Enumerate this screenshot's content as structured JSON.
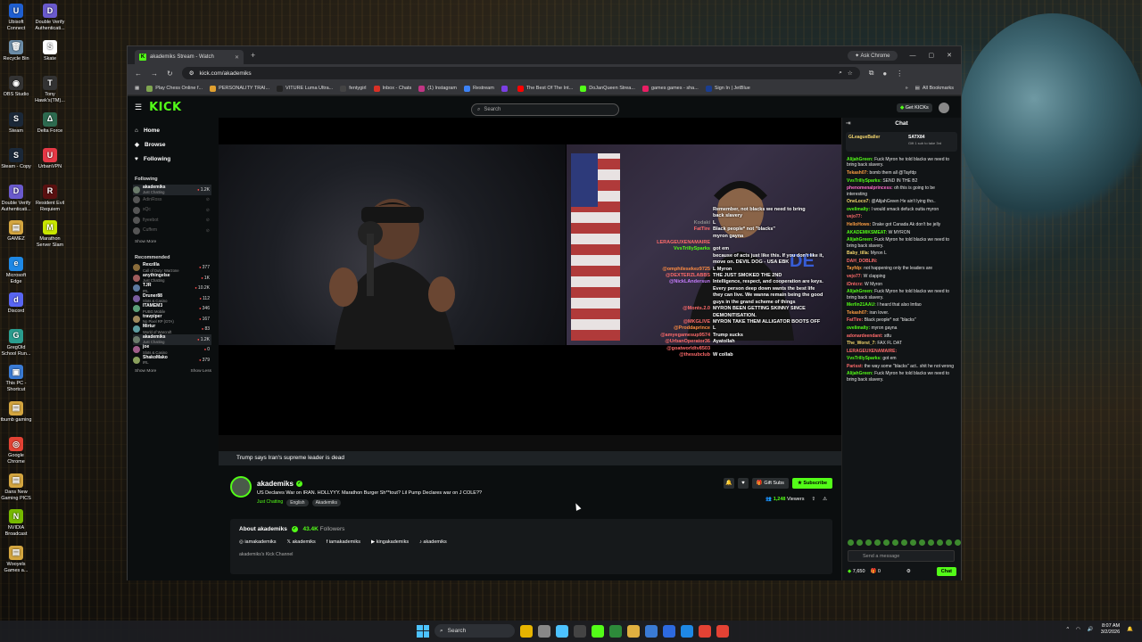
{
  "desktop": {
    "icons": [
      {
        "label": "Ubisoft Connect",
        "color": "#1f5fd1",
        "glyph": "U"
      },
      {
        "label": "Recycle Bin",
        "color": "#6b8ca8",
        "glyph": "🗑"
      },
      {
        "label": "OBS Studio",
        "color": "#333333",
        "glyph": "◉"
      },
      {
        "label": "Steam",
        "color": "#1b2838",
        "glyph": "S"
      },
      {
        "label": "Steam - Copy",
        "color": "#1b2838",
        "glyph": "S"
      },
      {
        "label": "Double Verify Authenticati...",
        "color": "#6a5acd",
        "glyph": "D"
      },
      {
        "label": "GAMEZ",
        "color": "#d4a640",
        "glyph": "▤"
      },
      {
        "label": "Microsoft Edge",
        "color": "#1e88e5",
        "glyph": "e"
      },
      {
        "label": "Discord",
        "color": "#5865f2",
        "glyph": "d"
      },
      {
        "label": "GregOld School Run...",
        "color": "#2a9d8f",
        "glyph": "G"
      },
      {
        "label": "This PC - Shortcut",
        "color": "#3a7bd5",
        "glyph": "▣"
      },
      {
        "label": "tbumb gaming",
        "color": "#d4a640",
        "glyph": "▤"
      },
      {
        "label": "Google Chrome",
        "color": "#e34234",
        "glyph": "◎"
      },
      {
        "label": "Dans New Gaming PICS",
        "color": "#d4a640",
        "glyph": "▤"
      },
      {
        "label": "NVIDIA Broadcast",
        "color": "#76b900",
        "glyph": "N"
      },
      {
        "label": "Wooyels Games a...",
        "color": "#d4a640",
        "glyph": "▤"
      }
    ],
    "icons_col2": [
      {
        "label": "Double Verify Authenticati...",
        "color": "#6a5acd",
        "glyph": "D"
      },
      {
        "label": "Skate",
        "color": "#ffffff",
        "glyph": "S"
      },
      {
        "label": "Tony Hawk's(TM)...",
        "color": "#333333",
        "glyph": "T"
      },
      {
        "label": "Delta Force",
        "color": "#2d6a4f",
        "glyph": "Δ"
      },
      {
        "label": "UrbanVPN",
        "color": "#e63946",
        "glyph": "U"
      },
      {
        "label": "Resident Evil Requiem",
        "color": "#5a1010",
        "glyph": "R"
      },
      {
        "label": "Marathon Server Slam",
        "color": "#c8e600",
        "glyph": "M"
      }
    ]
  },
  "browser": {
    "tab_title": "akademiks Stream - Watch",
    "ask_chrome": "Ask Chrome",
    "url": "kick.com/akademiks",
    "bookmarks": [
      {
        "label": "Play Chess Online f...",
        "color": "#7fa650"
      },
      {
        "label": "PERSONALITY TRAI...",
        "color": "#e0a030"
      },
      {
        "label": "VITURE Luma Ultra...",
        "color": "#222222"
      },
      {
        "label": "fentygirl",
        "color": "#444444"
      },
      {
        "label": "Inbox - Chats",
        "color": "#d93025"
      },
      {
        "label": "(1) Instagram",
        "color": "#c13584"
      },
      {
        "label": "Restream",
        "color": "#3c82f6"
      },
      {
        "label": "",
        "color": "#7b3fe4"
      },
      {
        "label": "The Best Of The Int...",
        "color": "#ff0000"
      },
      {
        "label": "DoJanQueen Strea...",
        "color": "#53fc18"
      },
      {
        "label": "games games - sha...",
        "color": "#e91e63"
      },
      {
        "label": "Sign In | JetBlue",
        "color": "#1a3d8f"
      }
    ],
    "all_bookmarks": "All Bookmarks"
  },
  "kick": {
    "logo": "KICK",
    "search_placeholder": "Search",
    "get_kicks": "Get KICKs",
    "nav": [
      {
        "label": "Home",
        "icon": "home-icon"
      },
      {
        "label": "Browse",
        "icon": "browse-icon"
      },
      {
        "label": "Following",
        "icon": "heart-icon"
      }
    ],
    "following_header": "Following",
    "following": [
      {
        "name": "akademiks",
        "sub": "Just Chatting",
        "viewers": "1.2K",
        "live": true,
        "color": "#6b7b6b"
      },
      {
        "name": "AdinRoss",
        "sub": "",
        "viewers": "",
        "live": false,
        "color": "#555555"
      },
      {
        "name": "xQc",
        "sub": "",
        "viewers": "",
        "live": false,
        "color": "#555555"
      },
      {
        "name": "fiyeebot",
        "sub": "",
        "viewers": "",
        "live": false,
        "color": "#555555"
      },
      {
        "name": "Cuffem",
        "sub": "",
        "viewers": "",
        "live": false,
        "color": "#555555"
      }
    ],
    "show_more_1": "Show More",
    "recommended_header": "Recommended",
    "recommended": [
      {
        "name": "Rexzilla",
        "sub": "Call of Duty: Warzone",
        "viewers": "377",
        "color": "#8a6d3b"
      },
      {
        "name": "anythingelse",
        "sub": "Just Chatting",
        "viewers": "1K",
        "color": "#a05d5d"
      },
      {
        "name": "TJR",
        "sub": "IRL",
        "viewers": "10.2K",
        "color": "#5d7aa0"
      },
      {
        "name": "Druner88",
        "sub": "Slots & Casino",
        "viewers": "112",
        "color": "#7a5da0"
      },
      {
        "name": "ITAMEM3",
        "sub": "PUBG Mobile",
        "viewers": "346",
        "color": "#5da07a"
      },
      {
        "name": "travpiper",
        "sub": "No Pixel RP (GTA)",
        "viewers": "167",
        "color": "#a08a5d"
      },
      {
        "name": "Mirtur",
        "sub": "World of Warcraft",
        "viewers": "83",
        "color": "#5d9ca0"
      },
      {
        "name": "akademiks",
        "sub": "Just Chatting",
        "viewers": "1.2K",
        "color": "#6b7b6b"
      },
      {
        "name": "joe",
        "sub": "Slots & Casino",
        "viewers": "0",
        "color": "#a05d8a"
      },
      {
        "name": "ShakoMako",
        "sub": "IRL",
        "viewers": "379",
        "color": "#8aa05d"
      }
    ],
    "show_more_2": "Show More",
    "show_less": "Show Less",
    "overlay_chat": [
      {
        "user": "",
        "text": "Remember, not blacks we need to bring",
        "color": "#888888"
      },
      {
        "user": "",
        "text": "back slavery",
        "color": "#888888"
      },
      {
        "user": "Kodaki",
        "text": "L",
        "color": "#888888"
      },
      {
        "user": "FatTire",
        "text": "Black people* not \"blacks\"",
        "color": "#ff6b6b"
      },
      {
        "user": "",
        "text": "myron gayna",
        "color": "#ff8c42"
      },
      {
        "user": "LERAGEUXENAMAIRE",
        "text": "",
        "color": "#ff6b6b"
      },
      {
        "user": "VvsTrillySparks",
        "text": "got em",
        "color": "#53fc18"
      },
      {
        "user": "",
        "text": "because of acts just like this. If you don't like it,",
        "color": "#ffffff"
      },
      {
        "user": "",
        "text": "move on. DEVIL DOG - USA EBK",
        "color": "#ffffff"
      },
      {
        "user": "@omphilesekez9725",
        "text": "L Myron",
        "color": "#ff8c42"
      },
      {
        "user": "@DEXTERZLABBS",
        "text": "THE JUST SMOKED THE 2ND",
        "color": "#ff6b6b"
      },
      {
        "user": "@NickLAndersun",
        "text": "Intelligence, respect, and cooperation are keys.",
        "color": "#c77dff"
      },
      {
        "user": "",
        "text": "Every person deep down wants the best life",
        "color": "#ffffff"
      },
      {
        "user": "",
        "text": "they can live. We wanna remain being the good",
        "color": "#ffffff"
      },
      {
        "user": "",
        "text": "guys in the grand scheme of things",
        "color": "#ffffff"
      },
      {
        "user": "@Monts.2.0",
        "text": "MYRON BEEN GETTING SKINNY SINCE",
        "color": "#ff6b6b"
      },
      {
        "user": "",
        "text": "DEMONITISATION.",
        "color": "#ffffff"
      },
      {
        "user": "@MKGLIVE",
        "text": "MYRON TAKE THEM ALLIGATOR BOOTS OFF",
        "color": "#ff6b6b"
      },
      {
        "user": "@Proddaprince",
        "text": "L",
        "color": "#ff8c42"
      },
      {
        "user": "@amyegamesup9574",
        "text": "Trump sucks",
        "color": "#ff6b6b"
      },
      {
        "user": "@UrbanOperator36",
        "text": "Ayatollah",
        "color": "#ff6b6b"
      },
      {
        "user": "@goatworldtv8503",
        "text": "",
        "color": "#ff6b6b"
      },
      {
        "user": "@thesubclub",
        "text": "W collab",
        "color": "#ff6b6b"
      }
    ],
    "stream_title_strip": "Trump says Iran's supreme leader is dead",
    "channel_name": "akademiks",
    "channel_title": "US Declares War on IRAN. HOLLYYY. Marathon Burger Sh**tout? Lil Pump Declares war on J COLE??",
    "category": "Just Chatting",
    "tags": [
      "English",
      "Akademiks"
    ],
    "gift_subs": "Gift Subs",
    "subscribe": "Subscribe",
    "viewers": "1,248",
    "viewers_label": "Viewers",
    "about_title": "About akademiks",
    "followers": "43.4K",
    "followers_label": "Followers",
    "socials": [
      {
        "label": "iamakademiks",
        "icon": "instagram-icon"
      },
      {
        "label": "akademiks",
        "icon": "x-icon"
      },
      {
        "label": "iamakademiks",
        "icon": "facebook-icon"
      },
      {
        "label": "kingakademiks",
        "icon": "youtube-icon"
      },
      {
        "label": "akademiks",
        "icon": "tiktok-icon"
      }
    ],
    "about_desc": "akademiks's Kick Channel",
    "chat_title": "Chat",
    "pinned_user": "GLeagueBaller",
    "pinned_user2": "SATX84",
    "pinned_text": "Gift 1 sub to take 3rd",
    "chat": [
      {
        "user": "AlijahGreen:",
        "text": "Fuck Myron he told blacks we need to bring back slavery.",
        "color": "#53fc18"
      },
      {
        "user": "Tekash07:",
        "text": "bomb them all @Tayfdp",
        "color": "#ff9f43"
      },
      {
        "user": "VvsTrillySparks:",
        "text": "SEND IN THE B2",
        "color": "#53fc18"
      },
      {
        "user": "phenomenalprincess:",
        "text": "oh this is going to be interesting",
        "color": "#ff6bcb"
      },
      {
        "user": "OneLoco7:",
        "text": "@AlijahGreen He ain't lying tho..",
        "color": "#f5d76e"
      },
      {
        "user": "ovelimalty:",
        "text": "I would smack defuck outta myron",
        "color": "#53fc18"
      },
      {
        "user": "vejo77:",
        "text": "",
        "color": "#ff6b6b"
      },
      {
        "user": "HelloHows:",
        "text": "Drake got Canada Ak don't be jelly",
        "color": "#ff9f43"
      },
      {
        "user": "AKADEMIKSMEAT:",
        "text": "W MYRON",
        "color": "#53fc18"
      },
      {
        "user": "AlijahGreen:",
        "text": "Fuck Myron he told blacks we need to bring back slavery.",
        "color": "#53fc18"
      },
      {
        "user": "Baby_tilla:",
        "text": "Myron L",
        "color": "#f5d76e"
      },
      {
        "user": "DAH_DOBLIN:",
        "text": "",
        "color": "#ff6b6b"
      },
      {
        "user": "Tayfdp:",
        "text": "not happening only the leaders are",
        "color": "#ff9f43"
      },
      {
        "user": "vejo77:",
        "text": "W clapping",
        "color": "#ff6b6b"
      },
      {
        "user": "iDntcrz:",
        "text": "W Myron",
        "color": "#ff6b6b"
      },
      {
        "user": "AlijahGreen:",
        "text": "Fuck Myron he told blacks we need to bring back slavery.",
        "color": "#53fc18"
      },
      {
        "user": "Merlin21AAU:",
        "text": "I heard that also lmfao",
        "color": "#53fc18"
      },
      {
        "user": "Tekash07:",
        "text": "iran lover.",
        "color": "#ff9f43"
      },
      {
        "user": "FatTire:",
        "text": "Black people* not \"blacks\"",
        "color": "#ff6b6b"
      },
      {
        "user": "ovelimalty:",
        "text": "myron gayna",
        "color": "#53fc18"
      },
      {
        "user": "adonardeendant:",
        "text": "stfu",
        "color": "#ff6b6b"
      },
      {
        "user": "The_Worst_7:",
        "text": "FAX FL DAT",
        "color": "#f5d76e"
      },
      {
        "user": "LERAGEUXENAMAIRE:",
        "text": "",
        "color": "#ff6b6b"
      },
      {
        "user": "VvsTrillySparks:",
        "text": "got em",
        "color": "#53fc18"
      },
      {
        "user": "Parisst:",
        "text": "the way some \"blacks\" act.. shit he not wrong",
        "color": "#ff6b6b"
      },
      {
        "user": "AlijahGreen:",
        "text": "Fuck Myron he told blacks we need to bring back slavery.",
        "color": "#53fc18"
      }
    ],
    "chat_placeholder": "Send a message",
    "kicks_balance": "7,650",
    "sub_count": "0",
    "chat_button": "Chat"
  },
  "taskbar": {
    "search": "Search",
    "time": "8:07 AM",
    "date": "3/2/2026",
    "apps": [
      "#e6b400",
      "#888888",
      "#4cc2ff",
      "#444444",
      "#53fc18",
      "#2d8a3a",
      "#e0b040",
      "#3a7bd5",
      "#2d6ae0",
      "#1e88e5",
      "#e34234",
      "#e34234"
    ]
  },
  "colors": {
    "kick_green": "#53fc18",
    "page_bg": "#0b0e0f",
    "live_red": "#ff4b4b"
  }
}
